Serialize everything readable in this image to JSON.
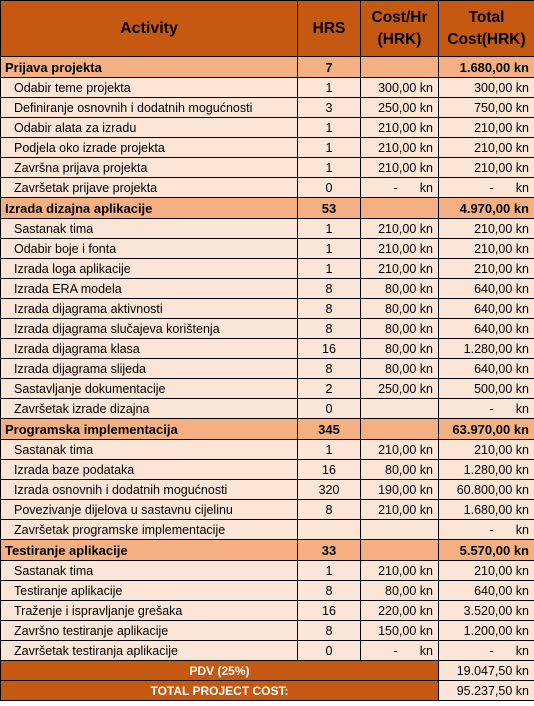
{
  "header": {
    "activity": "Activity",
    "hrs": "HRS",
    "cost_line1": "Cost/Hr",
    "cost_line2": "(HRK)",
    "total_line1": "Total",
    "total_line2": "Cost(HRK)"
  },
  "groups": [
    {
      "name": "Prijava projekta",
      "hrs": "7",
      "total": "1.680,00 kn",
      "items": [
        {
          "activity": "Odabir teme projekta",
          "hrs": "1",
          "cost": "300,00 kn",
          "total": "300,00 kn"
        },
        {
          "activity": "Definiranje osnovnih i dodatnih mogućnosti",
          "hrs": "3",
          "cost": "250,00 kn",
          "total": "750,00 kn"
        },
        {
          "activity": "Odabir alata za izradu",
          "hrs": "1",
          "cost": "210,00 kn",
          "total": "210,00 kn"
        },
        {
          "activity": "Podjela oko izrade projekta",
          "hrs": "1",
          "cost": "210,00 kn",
          "total": "210,00 kn"
        },
        {
          "activity": "Završna prijava projekta",
          "hrs": "1",
          "cost": "210,00 kn",
          "total": "210,00 kn"
        },
        {
          "activity": "Završetak prijave projekta",
          "hrs": "0",
          "cost": "-",
          "total": "-",
          "zero": true
        }
      ]
    },
    {
      "name": "Izrada dizajna aplikacije",
      "hrs": "53",
      "total": "4.970,00 kn",
      "items": [
        {
          "activity": "Sastanak tima",
          "hrs": "1",
          "cost": "210,00 kn",
          "total": "210,00 kn"
        },
        {
          "activity": "Odabir boje i fonta",
          "hrs": "1",
          "cost": "210,00 kn",
          "total": "210,00 kn"
        },
        {
          "activity": "Izrada loga aplikacije",
          "hrs": "1",
          "cost": "210,00 kn",
          "total": "210,00 kn"
        },
        {
          "activity": "Izrada ERA modela",
          "hrs": "8",
          "cost": "80,00 kn",
          "total": "640,00 kn"
        },
        {
          "activity": "Izrada dijagrama aktivnosti",
          "hrs": "8",
          "cost": "80,00 kn",
          "total": "640,00 kn"
        },
        {
          "activity": "Izrada dijagrama slučajeva korištenja",
          "hrs": "8",
          "cost": "80,00 kn",
          "total": "640,00 kn"
        },
        {
          "activity": "Izrada dijagrama klasa",
          "hrs": "16",
          "cost": "80,00 kn",
          "total": "1.280,00 kn"
        },
        {
          "activity": "Izrada dijagrama slijeda",
          "hrs": "8",
          "cost": "80,00 kn",
          "total": "640,00 kn"
        },
        {
          "activity": "Sastavljanje dokumentacije",
          "hrs": "2",
          "cost": "250,00 kn",
          "total": "500,00 kn"
        },
        {
          "activity": "Završetak izrade dizajna",
          "hrs": "0",
          "cost": "",
          "total": "-",
          "zero_total_only": true
        }
      ]
    },
    {
      "name": "Programska implementacija",
      "hrs": "345",
      "total": "63.970,00 kn",
      "items": [
        {
          "activity": "Sastanak tima",
          "hrs": "1",
          "cost": "210,00 kn",
          "total": "210,00 kn"
        },
        {
          "activity": "Izrada baze podataka",
          "hrs": "16",
          "cost": "80,00 kn",
          "total": "1.280,00 kn"
        },
        {
          "activity": "Izrada osnovnih i dodatnih mogućnosti",
          "hrs": "320",
          "cost": "190,00 kn",
          "total": "60.800,00 kn"
        },
        {
          "activity": "Povezivanje dijelova u sastavnu cijelinu",
          "hrs": "8",
          "cost": "210,00 kn",
          "total": "1.680,00 kn"
        },
        {
          "activity": "Završetak programske implementacije",
          "hrs": "",
          "cost": "",
          "total": "-",
          "zero_total_only": true
        }
      ]
    },
    {
      "name": "Testiranje aplikacije",
      "hrs": "33",
      "total": "5.570,00 kn",
      "items": [
        {
          "activity": "Sastanak tima",
          "hrs": "1",
          "cost": "210,00 kn",
          "total": "210,00 kn"
        },
        {
          "activity": "Testiranje aplikacije",
          "hrs": "8",
          "cost": "80,00 kn",
          "total": "640,00 kn"
        },
        {
          "activity": "Traženje i ispravljanje grešaka",
          "hrs": "16",
          "cost": "220,00 kn",
          "total": "3.520,00 kn"
        },
        {
          "activity": "Završno testiranje aplikacije",
          "hrs": "8",
          "cost": "150,00 kn",
          "total": "1.200,00 kn"
        },
        {
          "activity": "Završetak testiranja aplikacije",
          "hrs": "0",
          "cost": "-",
          "total": "-",
          "zero": true
        }
      ]
    }
  ],
  "summary": {
    "pdv_label": "PDV (25%)",
    "pdv_value": "19.047,50 kn",
    "total_label": "TOTAL PROJECT COST:",
    "total_value": "95.237,50 kn"
  },
  "kn_suffix": "kn",
  "colors": {
    "header_bg": "#c65911",
    "group_bg": "#f4b083",
    "item_bg": "#fbe5d6"
  }
}
